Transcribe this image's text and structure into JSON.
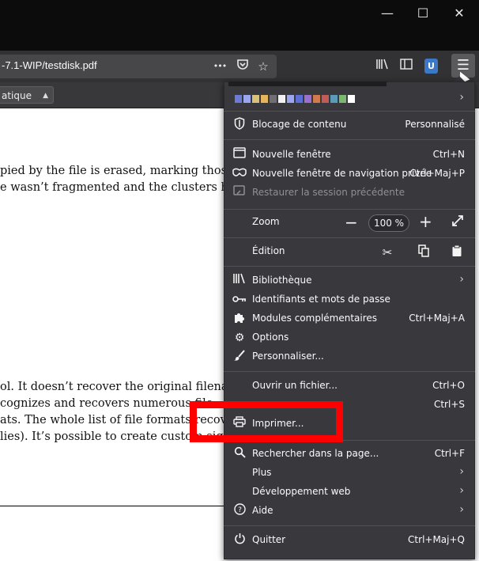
{
  "window": {
    "minimize": "—",
    "maximize": "☐",
    "close": "✕"
  },
  "urlbar": {
    "url": "-7.1-WIP/testdisk.pdf",
    "more": "•••"
  },
  "pdf_toolbar": {
    "zoom_value": "atique"
  },
  "pdf": {
    "lines": [
      "pied by the file is erased, marking those sec",
      "e wasn’t fragmented and the clusters haven",
      "ol. It doesn’t recover the original filenames",
      "cognizes and recovers numerous file",
      "ats. The whole list of file formats recovere",
      "lies). It’s possible to create custom signatu"
    ]
  },
  "menu": {
    "swatch_colors": [
      "#6d7bd8",
      "#9aa6f0",
      "#d8c27a",
      "#e6b45a",
      "#6f6f73",
      "#f2f2f2",
      "#9aa6f0",
      "#5b6fd6",
      "#9a6fd0",
      "#d07a4e",
      "#c25a5a",
      "#5b9ab8",
      "#7ab86f",
      "#ffffff"
    ],
    "blocking": {
      "label": "Blocage de contenu",
      "value": "Personnalisé"
    },
    "new_window": {
      "label": "Nouvelle fenêtre",
      "shortcut": "Ctrl+N"
    },
    "private_window": {
      "label": "Nouvelle fenêtre de navigation privée",
      "shortcut": "Ctrl+Maj+P"
    },
    "restore_session": {
      "label": "Restaurer la session précédente"
    },
    "zoom": {
      "label": "Zoom",
      "minus": "−",
      "value": "100 %",
      "plus": "+"
    },
    "edit": {
      "label": "Édition"
    },
    "library": {
      "label": "Bibliothèque"
    },
    "logins": {
      "label": "Identifiants et mots de passe"
    },
    "addons": {
      "label": "Modules complémentaires",
      "shortcut": "Ctrl+Maj+A"
    },
    "options": {
      "label": "Options"
    },
    "customize": {
      "label": "Personnaliser..."
    },
    "open_file": {
      "label": "Ouvrir un fichier...",
      "shortcut": "Ctrl+O"
    },
    "save": {
      "shortcut": "Ctrl+S"
    },
    "print": {
      "label": "Imprimer..."
    },
    "find": {
      "label": "Rechercher dans la page...",
      "shortcut": "Ctrl+F"
    },
    "more": {
      "label": "Plus"
    },
    "webdev": {
      "label": "Développement web"
    },
    "help": {
      "label": "Aide"
    },
    "quit": {
      "label": "Quitter",
      "shortcut": "Ctrl+Maj+Q"
    }
  }
}
